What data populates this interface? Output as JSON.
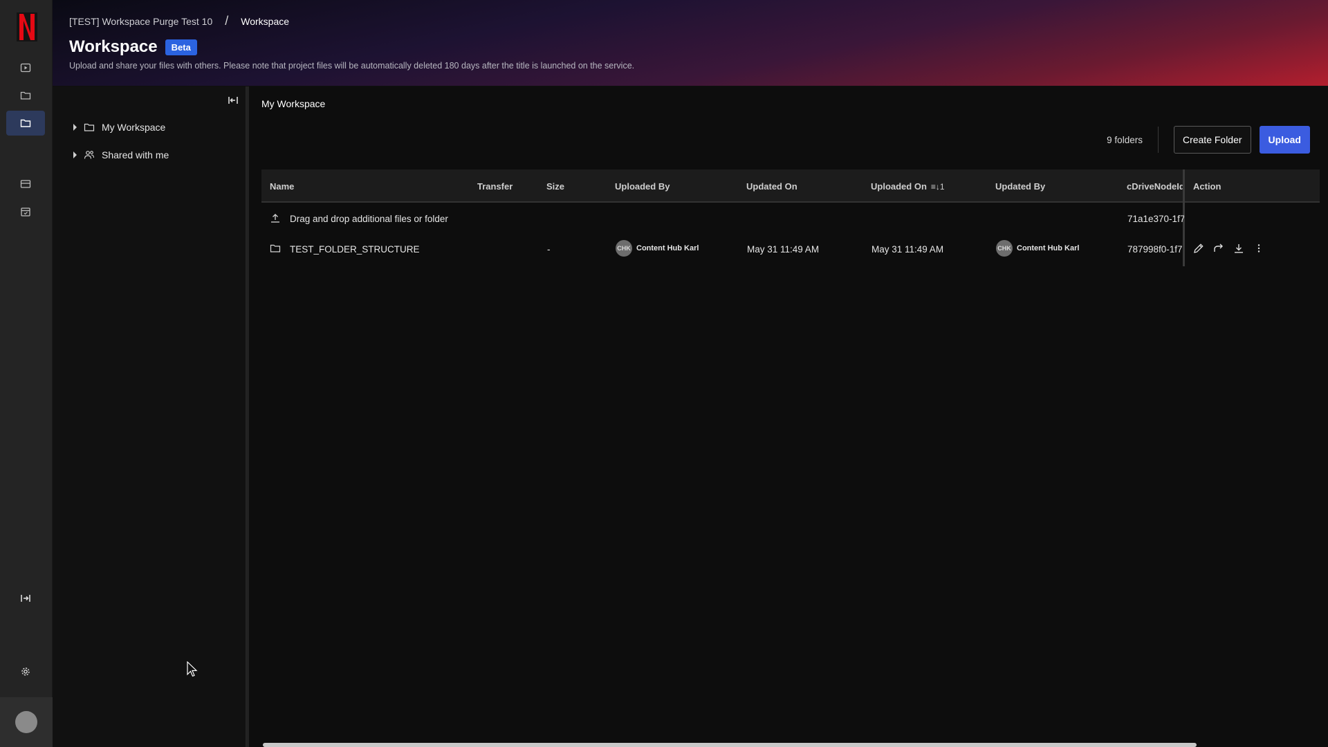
{
  "brand": {
    "logo_letter": "N",
    "logo_color": "#e50914"
  },
  "nav": {
    "items": [
      {
        "name": "titles-icon",
        "active": false
      },
      {
        "name": "folder-icon",
        "active": false
      },
      {
        "name": "workspace-folder-icon",
        "active": true
      },
      {
        "name": "card-icon",
        "active": false
      },
      {
        "name": "calendar-icon",
        "active": false
      }
    ],
    "expand_icon": "expand-sidebar-icon",
    "settings_icon": "gear-icon"
  },
  "header": {
    "breadcrumb": {
      "parent": "[TEST] Workspace Purge Test 10",
      "separator": "/",
      "current": "Workspace"
    },
    "title": "Workspace",
    "badge": "Beta",
    "subtitle": "Upload and share your files with others. Please note that project files will be automatically deleted 180 days after the title is launched on the service."
  },
  "tree": {
    "items": [
      {
        "label": "My Workspace",
        "icon": "folder-icon"
      },
      {
        "label": "Shared with me",
        "icon": "shared-users-icon"
      }
    ]
  },
  "main": {
    "title": "My Workspace",
    "folder_count": "9 folders",
    "create_folder_label": "Create Folder",
    "upload_label": "Upload"
  },
  "table": {
    "columns": [
      "Name",
      "Transfer",
      "Size",
      "Uploaded By",
      "Updated On",
      "Uploaded On",
      "Updated By",
      "cDriveNodeId",
      "Action"
    ],
    "sort_indicator": "≡↓1",
    "dropzone": {
      "label": "Drag and drop additional files or folder",
      "node_id": "71a1e370-1f7"
    },
    "rows": [
      {
        "name": "TEST_FOLDER_STRUCTURE",
        "transfer": "",
        "size": "-",
        "uploaded_by": {
          "initials": "CHK",
          "name": "Content Hub Karl"
        },
        "updated_on": "May 31 11:49 AM",
        "uploaded_on": "May 31 11:49 AM",
        "updated_by": {
          "initials": "CHK",
          "name": "Content Hub Karl"
        },
        "node_id": "787998f0-1f7"
      }
    ]
  },
  "colors": {
    "accent": "#3b5ce0",
    "badge": "#2b63e0",
    "active_nav": "#2d3a5c"
  }
}
